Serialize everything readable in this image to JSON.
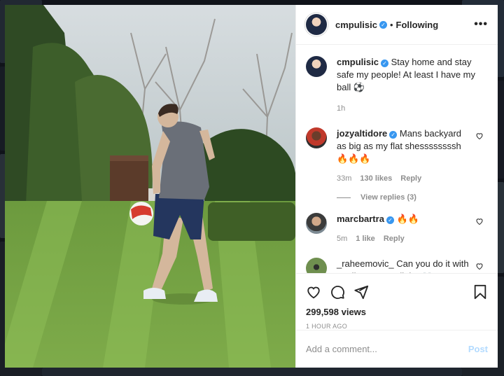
{
  "post": {
    "author": "cmpulisic",
    "follow_label": "Following",
    "more_label": "•••",
    "caption": {
      "username": "cmpulisic",
      "text": "Stay home and stay safe my people! At least I have my ball ⚽",
      "time": "1h"
    },
    "comments": [
      {
        "username": "jozyaltidore",
        "text": "Mans backyard as big as my flat shessssssssh 🔥🔥🔥",
        "time": "33m",
        "likes": "130 likes",
        "reply": "Reply",
        "view_replies": "View replies (3)"
      },
      {
        "username": "marcbartra",
        "text": "🔥🔥",
        "time": "5m",
        "likes": "1 like",
        "reply": "Reply"
      },
      {
        "username": "_raheemovic_",
        "text": "Can you do it with a toilet paper roll tho 👀",
        "time": "",
        "likes": "",
        "reply": ""
      }
    ],
    "views": "299,598 views",
    "ago": "1 HOUR AGO",
    "comment_placeholder": "Add a comment...",
    "post_label": "Post",
    "verified_mark": "✓"
  },
  "colors": {
    "verified": "#3897f0",
    "post_disabled": "#b3dbff",
    "meta": "#8e8e8e"
  },
  "icons": [
    "heart-icon",
    "comment-icon",
    "share-icon",
    "bookmark-icon",
    "more-icon",
    "verified-icon"
  ]
}
